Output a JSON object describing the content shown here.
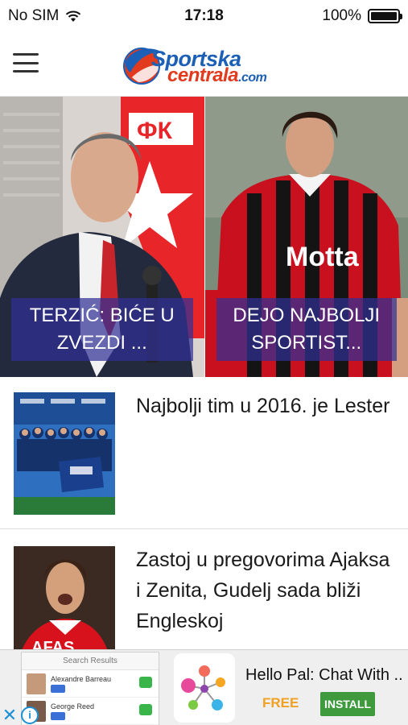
{
  "status_bar": {
    "carrier": "No SIM",
    "time": "17:18",
    "battery": "100%",
    "battery_level": 1.0
  },
  "header": {
    "logo_line_1": "Sportska",
    "logo_line_2": "centrala",
    "logo_suffix": ".com",
    "menu_icon": "hamburger-icon"
  },
  "hero": [
    {
      "caption_line_1": "TERZIĆ: BIĆE U",
      "caption_line_2": "ZVEZDI ..."
    },
    {
      "caption_line_1": "DEJO NAJBOLJI",
      "caption_line_2": "SPORTIST..."
    }
  ],
  "articles": [
    {
      "title": "Najbolji tim u 2016. je Lester"
    },
    {
      "title": "Zastoj u pregovorima Ajaksa i Zenita, Gudelj sada bliži Engleskoj"
    }
  ],
  "ad": {
    "title": "Hello Pal: Chat With ...",
    "price": "FREE",
    "install_label": "INSTALL",
    "close_icon": "close-icon",
    "info_icon": "info-icon",
    "preview": {
      "header": "Search Results",
      "row_1_name": "Alexandre Barreau",
      "row_2_name": "George Reed"
    }
  },
  "colors": {
    "brand_blue": "#1b5fb6",
    "brand_red": "#e23a1c",
    "caption_overlay": "#303096",
    "install_green": "#3e9a3c",
    "free_orange": "#f0a023"
  }
}
